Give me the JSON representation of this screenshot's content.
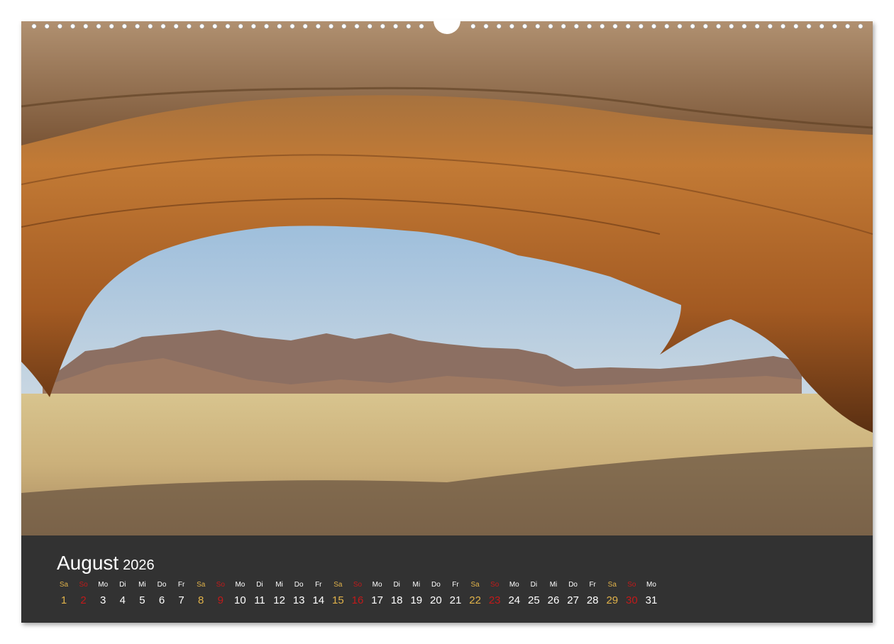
{
  "calendar": {
    "month": "August",
    "year": "2026"
  },
  "colors": {
    "panel": "#323232",
    "weekday": "#ffffff",
    "saturday": "#e0b24a",
    "sunday": "#c21a1a"
  },
  "days": [
    {
      "dow": "Sa",
      "num": "1",
      "type": "sat"
    },
    {
      "dow": "So",
      "num": "2",
      "type": "sun"
    },
    {
      "dow": "Mo",
      "num": "3",
      "type": "weekday"
    },
    {
      "dow": "Di",
      "num": "4",
      "type": "weekday"
    },
    {
      "dow": "Mi",
      "num": "5",
      "type": "weekday"
    },
    {
      "dow": "Do",
      "num": "6",
      "type": "weekday"
    },
    {
      "dow": "Fr",
      "num": "7",
      "type": "weekday"
    },
    {
      "dow": "Sa",
      "num": "8",
      "type": "sat"
    },
    {
      "dow": "So",
      "num": "9",
      "type": "sun"
    },
    {
      "dow": "Mo",
      "num": "10",
      "type": "weekday"
    },
    {
      "dow": "Di",
      "num": "11",
      "type": "weekday"
    },
    {
      "dow": "Mi",
      "num": "12",
      "type": "weekday"
    },
    {
      "dow": "Do",
      "num": "13",
      "type": "weekday"
    },
    {
      "dow": "Fr",
      "num": "14",
      "type": "weekday"
    },
    {
      "dow": "Sa",
      "num": "15",
      "type": "sat"
    },
    {
      "dow": "So",
      "num": "16",
      "type": "sun"
    },
    {
      "dow": "Mo",
      "num": "17",
      "type": "weekday"
    },
    {
      "dow": "Di",
      "num": "18",
      "type": "weekday"
    },
    {
      "dow": "Mi",
      "num": "19",
      "type": "weekday"
    },
    {
      "dow": "Do",
      "num": "20",
      "type": "weekday"
    },
    {
      "dow": "Fr",
      "num": "21",
      "type": "weekday"
    },
    {
      "dow": "Sa",
      "num": "22",
      "type": "sat"
    },
    {
      "dow": "So",
      "num": "23",
      "type": "sun"
    },
    {
      "dow": "Mo",
      "num": "24",
      "type": "weekday"
    },
    {
      "dow": "Di",
      "num": "25",
      "type": "weekday"
    },
    {
      "dow": "Mi",
      "num": "26",
      "type": "weekday"
    },
    {
      "dow": "Do",
      "num": "27",
      "type": "weekday"
    },
    {
      "dow": "Fr",
      "num": "28",
      "type": "weekday"
    },
    {
      "dow": "Sa",
      "num": "29",
      "type": "sat"
    },
    {
      "dow": "So",
      "num": "30",
      "type": "sun"
    },
    {
      "dow": "Mo",
      "num": "31",
      "type": "weekday"
    }
  ]
}
